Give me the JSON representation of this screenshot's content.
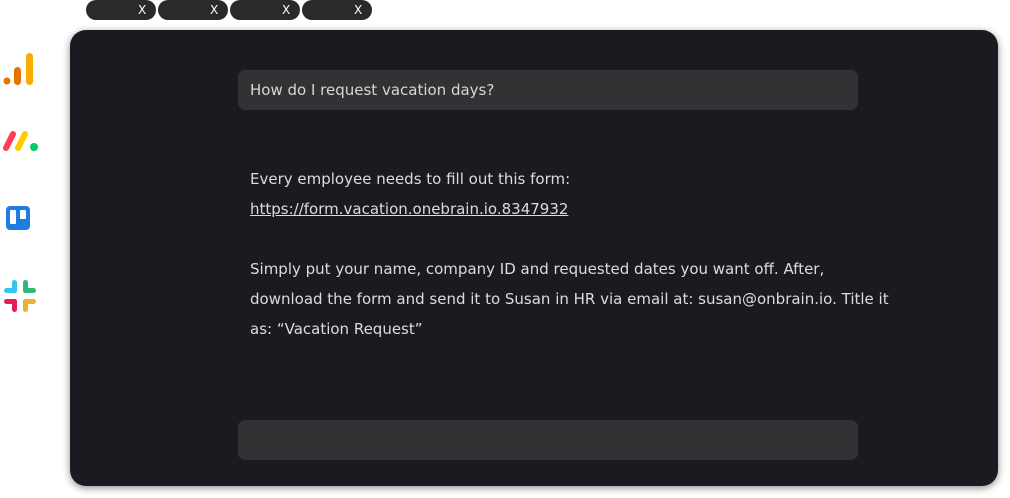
{
  "tabs": [
    {
      "close_label": "X"
    },
    {
      "close_label": "X"
    },
    {
      "close_label": "X"
    },
    {
      "close_label": "X"
    }
  ],
  "dock": [
    {
      "icon": "google-analytics-icon"
    },
    {
      "icon": "monday-icon"
    },
    {
      "icon": "trello-icon"
    },
    {
      "icon": "slack-icon"
    }
  ],
  "chat": {
    "question": "How do I request vacation days?",
    "answer_intro": "Every employee needs to fill out this form:",
    "answer_link": "https://form.vacation.onebrain.io.8347932",
    "answer_body": "Simply put your name, company ID and requested dates you want off. After, download the form and send it to Susan in HR via email at: susan@onbrain.io. Title it as: “Vacation Request”",
    "input_value": "",
    "input_placeholder": ""
  },
  "colors": {
    "panel_bg": "#1b1a21",
    "field_bg": "#323234",
    "tab_bg": "#2a2a2d",
    "analytics_orange": "#f9ab00",
    "analytics_dark_orange": "#e37400",
    "monday_red": "#ff3d57",
    "monday_yellow": "#ffcb00",
    "monday_green": "#00ca72",
    "trello_blue": "#1d7de0",
    "slack_blue": "#36c5f0",
    "slack_green": "#2eb67d",
    "slack_red": "#e01e5a",
    "slack_yellow": "#ecb22e"
  }
}
